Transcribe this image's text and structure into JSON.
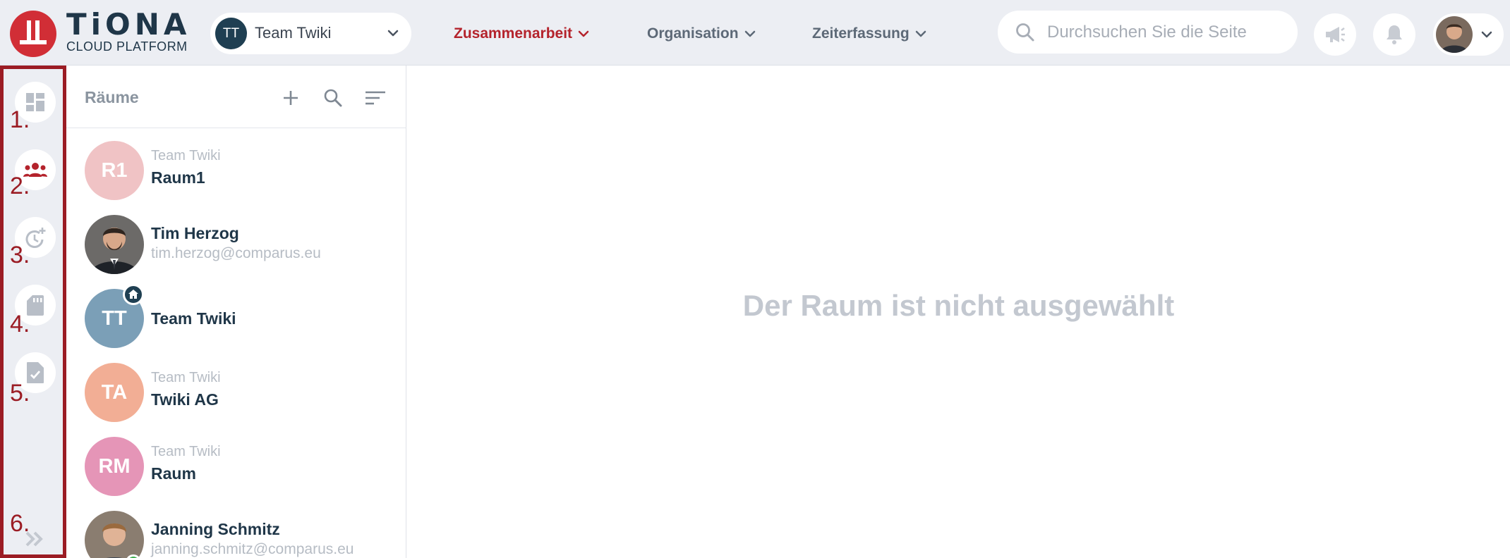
{
  "brand": {
    "name": "TiONA",
    "subtitle": "CLOUD PLATFORM"
  },
  "team_selector": {
    "initials": "TT",
    "name": "Team Twiki"
  },
  "nav": [
    {
      "label": "Zusammenarbeit",
      "active": true
    },
    {
      "label": "Organisation",
      "active": false
    },
    {
      "label": "Zeiterfassung",
      "active": false
    }
  ],
  "search": {
    "placeholder": "Durchsuchen Sie die Seite"
  },
  "rail": {
    "numbers": [
      "1.",
      "2.",
      "3.",
      "4.",
      "5.",
      "6."
    ],
    "items": [
      "dashboard-icon",
      "people-icon",
      "clock-add-icon",
      "sd-card-icon",
      "document-check-icon"
    ]
  },
  "rooms_panel": {
    "title": "Räume",
    "rooms": [
      {
        "initials": "R1",
        "team": "Team Twiki",
        "name": "Raum1",
        "color": "#f0c3c5"
      },
      {
        "name": "Tim Herzog",
        "email": "tim.herzog@comparus.eu",
        "photo": true
      },
      {
        "initials": "TT",
        "name": "Team Twiki",
        "color": "#7b9fb7",
        "home": true
      },
      {
        "initials": "TA",
        "team": "Team Twiki",
        "name": "Twiki AG",
        "color": "#f2ae95"
      },
      {
        "initials": "RM",
        "team": "Team Twiki",
        "name": "Raum",
        "color": "#e595b7"
      },
      {
        "name": "Janning Schmitz",
        "email": "janning.schmitz@comparus.eu",
        "photo": true,
        "online": true
      }
    ]
  },
  "main": {
    "empty_message": "Der Raum ist nicht ausgewählt"
  },
  "colors": {
    "accent": "#b4232c",
    "logo": "#d12e36",
    "dark": "#1f3648",
    "rail_outline": "#9b1c24"
  }
}
